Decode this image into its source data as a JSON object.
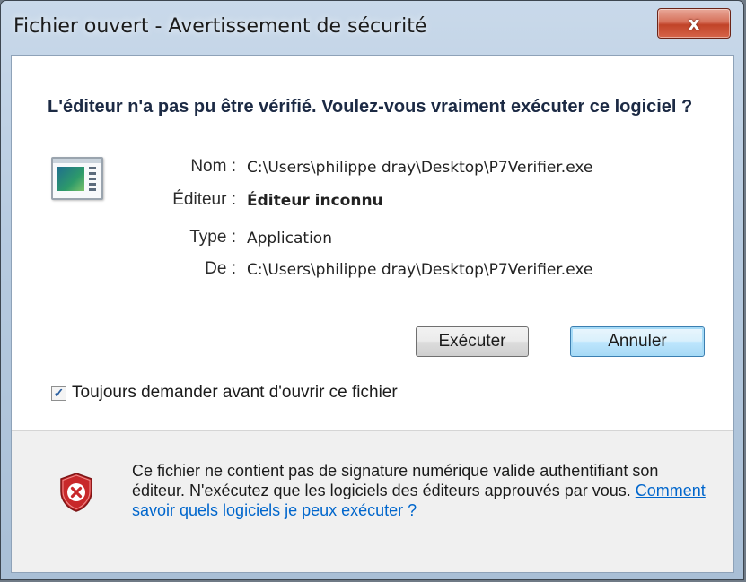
{
  "window": {
    "title": "Fichier ouvert - Avertissement de sécurité",
    "close_glyph": "x"
  },
  "heading": "L'éditeur n'a pas pu être vérifié. Voulez-vous vraiment exécuter ce logiciel ?",
  "icon_name": "application-icon",
  "details": [
    {
      "label": "Nom :",
      "value": "C:\\Users\\philippe dray\\Desktop\\P7Verifier.exe",
      "bold": false
    },
    {
      "label": "Éditeur :",
      "value": "Éditeur inconnu",
      "bold": true
    },
    {
      "label": "Type :",
      "value": "Application",
      "bold": false
    },
    {
      "label": "De :",
      "value": "C:\\Users\\philippe dray\\Desktop\\P7Verifier.exe",
      "bold": false
    }
  ],
  "buttons": {
    "run": "Exécuter",
    "cancel": "Annuler"
  },
  "checkbox": {
    "label": "Toujours demander avant d'ouvrir ce fichier",
    "checked": true,
    "check_glyph": "✓"
  },
  "warning": {
    "icon_name": "security-shield-icon",
    "text": "Ce fichier ne contient pas de signature numérique valide authentifiant son éditeur. N'exécutez que les logiciels des éditeurs approuvés par vous. ",
    "link": "Comment savoir quels logiciels je peux exécuter ?"
  },
  "colors": {
    "heading": "#1c2a44",
    "link": "#0066cc",
    "shield_red": "#c8282a"
  }
}
